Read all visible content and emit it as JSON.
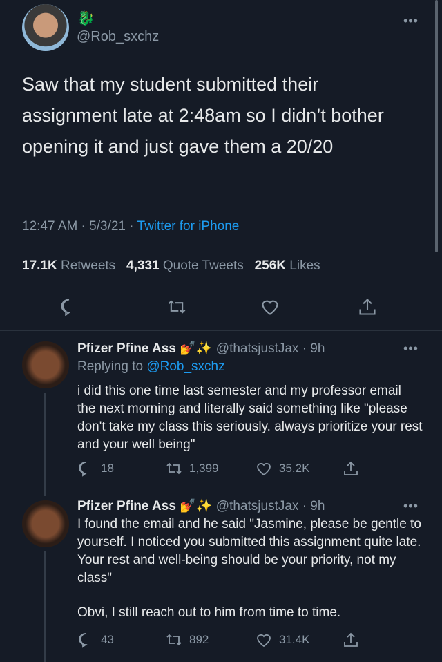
{
  "tweet": {
    "handle": "@Rob_sxchz",
    "text": "Saw that my student submitted their assignment late at 2:48am so I didn’t bother opening it and just gave them a 20/20",
    "time": "12:47 AM · 5/3/21 · ",
    "source": "Twitter for iPhone",
    "retweets_count": "17.1K",
    "retweets_label": "Retweets",
    "quotes_count": "4,331",
    "quotes_label": "Quote Tweets",
    "likes_count": "256K",
    "likes_label": "Likes"
  },
  "replies": [
    {
      "name": "Pfizer Pfine Ass",
      "emoji": "💅✨",
      "handle": "@thatsjustJax · 9h",
      "replying_label": "Replying to ",
      "replying_to": "@Rob_sxchz",
      "text": "i did this one time last semester and my professor email the next morning and literally said something like \"please don't take my class this seriously. always prioritize your rest and your well being\"",
      "replies": "18",
      "retweets": "1,399",
      "likes": "35.2K"
    },
    {
      "name": "Pfizer Pfine Ass",
      "emoji": "💅✨",
      "handle": "@thatsjustJax · 9h",
      "text": "I found the email and he said \"Jasmine, please be gentle to yourself. I noticed you submitted this assignment quite late. Your rest and well-being should be your priority, not my class\"",
      "text2": "Obvi, I still reach out to him from time to time.",
      "replies": "43",
      "retweets": "892",
      "likes": "31.4K"
    }
  ]
}
